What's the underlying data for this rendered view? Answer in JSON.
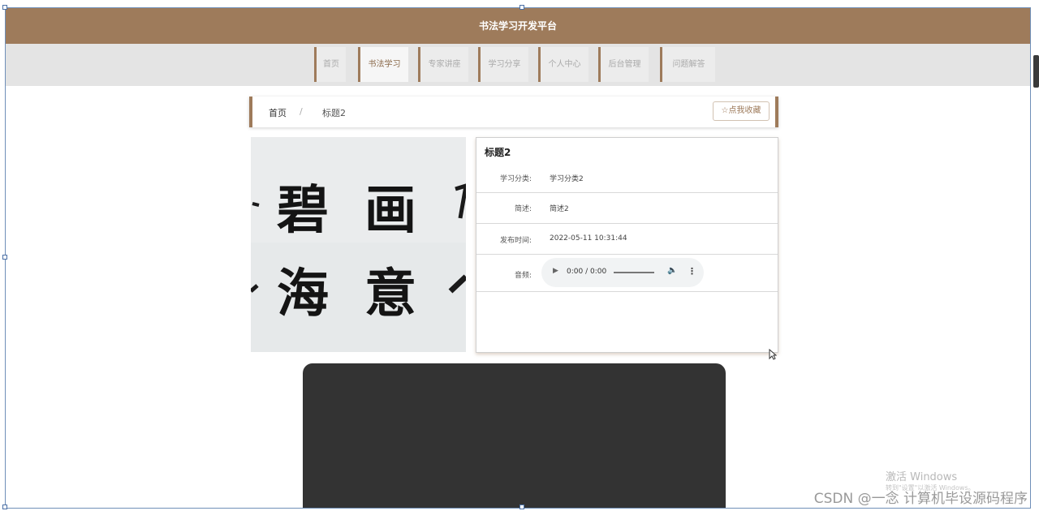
{
  "header": {
    "title": "书法学习开发平台"
  },
  "nav": {
    "items": [
      {
        "label": "首页"
      },
      {
        "label": "书法学习"
      },
      {
        "label": "专家讲座"
      },
      {
        "label": "学习分享"
      },
      {
        "label": "个人中心"
      },
      {
        "label": "后台管理"
      },
      {
        "label": "问题解答"
      }
    ]
  },
  "breadcrumb": {
    "home": "首页",
    "separator": "/",
    "current": "标题2"
  },
  "favorite_button": {
    "label": "☆点我收藏"
  },
  "image": {
    "chars_row1": [
      "碧",
      "画"
    ],
    "chars_row2": [
      "海",
      "意"
    ]
  },
  "detail": {
    "title": "标题2",
    "rows": [
      {
        "label": "学习分类:",
        "value": "学习分类2"
      },
      {
        "label": "简述:",
        "value": "简述2"
      },
      {
        "label": "发布时间:",
        "value": "2022-05-11 10:31:44"
      }
    ],
    "audio_label": "音频:",
    "audio_time": "0:00 / 0:00"
  },
  "overlay": {
    "windows_activate_title": "激活 Windows",
    "windows_activate_sub": "转到\"设置\"以激活 Windows。",
    "csdn_watermark": "CSDN @一念 计算机毕设源码程序"
  },
  "colors": {
    "brand": "#9e7b5b",
    "nav_bg": "#e4e4e4",
    "video_bg": "#333333"
  }
}
